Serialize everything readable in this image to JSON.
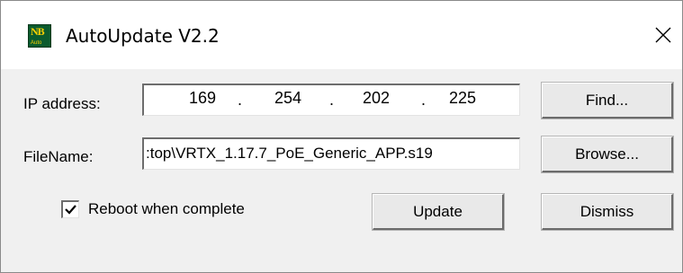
{
  "window": {
    "title": "AutoUpdate V2.2",
    "icon": {
      "name": "nb-auto-app-icon",
      "text_main": "NB",
      "text_sub": "Auto",
      "color": "#0b5b2e",
      "accent": "#ffd200"
    }
  },
  "ip": {
    "label": "IP address:",
    "octets": [
      "169",
      "254",
      "202",
      "225"
    ],
    "separator": "."
  },
  "file": {
    "label": "FileName:",
    "value": ":top\\VRTX_1.17.7_PoE_Generic_APP.s19"
  },
  "reboot": {
    "label": "Reboot when complete",
    "checked": true
  },
  "buttons": {
    "find": "Find...",
    "browse": "Browse...",
    "update": "Update",
    "dismiss": "Dismiss"
  }
}
